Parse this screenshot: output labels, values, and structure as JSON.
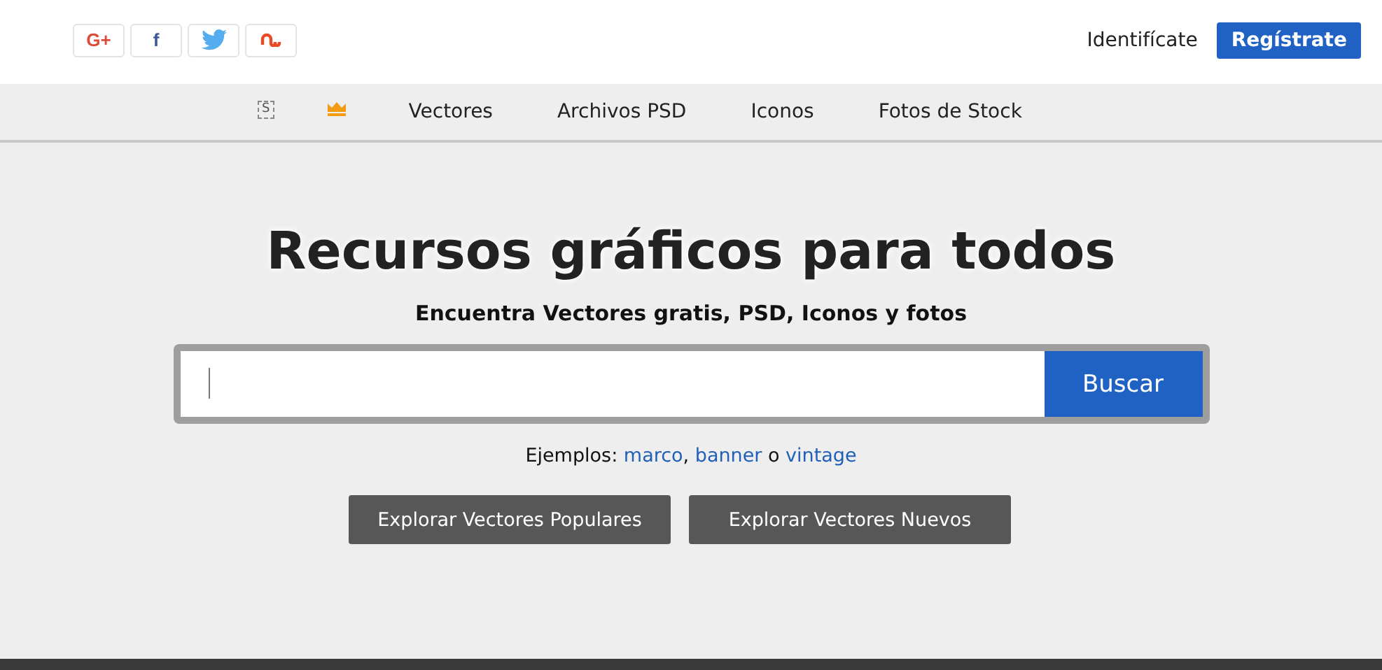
{
  "social": [
    {
      "kind": "google",
      "label": "G+"
    },
    {
      "kind": "facebook",
      "label": "f"
    },
    {
      "kind": "twitter"
    },
    {
      "kind": "stumbleupon"
    }
  ],
  "account": {
    "login": "Identifícate",
    "register": "Regístrate"
  },
  "nav": {
    "badge": "S",
    "items": [
      "Vectores",
      "Archivos PSD",
      "Iconos",
      "Fotos de Stock"
    ]
  },
  "hero": {
    "title": "Recursos gráficos para todos",
    "subtitle": "Encuentra Vectores gratis, PSD, Iconos y fotos",
    "search_button": "Buscar",
    "examples": {
      "prefix": "Ejemplos:",
      "links": [
        "marco",
        "banner",
        "vintage"
      ],
      "separator": ",",
      "conjunction": "o"
    },
    "buttons": [
      "Explorar Vectores Populares",
      "Explorar Vectores Nuevos"
    ]
  }
}
